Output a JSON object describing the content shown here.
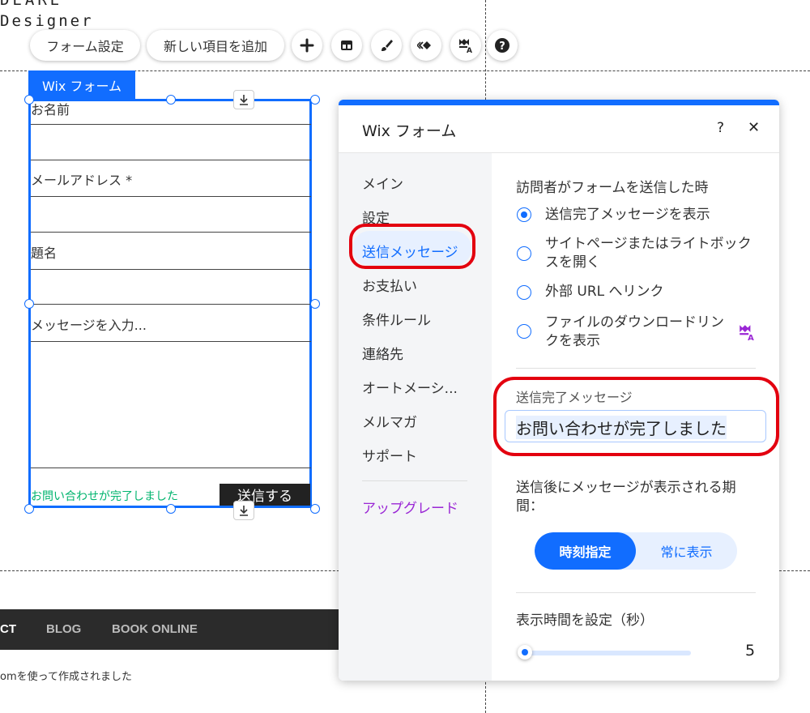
{
  "site": {
    "title_partial": "DEARE",
    "subtitle_partial": "Designer"
  },
  "toolbar": {
    "form_settings_label": "フォーム設定",
    "add_item_label": "新しい項目を追加",
    "icons": [
      "plus-icon",
      "layout-icon",
      "brush-icon",
      "animation-icon",
      "premium-icon",
      "help-icon"
    ]
  },
  "form": {
    "tag_label": "Wix フォーム",
    "fields": [
      {
        "label": "お名前"
      },
      {
        "label": "メールアドレス *"
      },
      {
        "label": "題名"
      },
      {
        "label": "メッセージを入力..."
      }
    ],
    "success_text": "お問い合わせが完了しました",
    "submit_label": "送信する",
    "success_color": "#00b46e",
    "accent": "#116dff"
  },
  "footer": {
    "nav_items": [
      "CT",
      "BLOG",
      "BOOK ONLINE"
    ],
    "credit_text": "omを使って作成されました"
  },
  "panel": {
    "title": "Wix フォーム",
    "help_glyph": "?",
    "close_glyph": "✕",
    "nav": [
      {
        "label": "メイン"
      },
      {
        "label": "設定"
      },
      {
        "label": "送信メッセージ",
        "selected": true
      },
      {
        "label": "お支払い"
      },
      {
        "label": "条件ルール"
      },
      {
        "label": "連絡先"
      },
      {
        "label": "オートメーシ..."
      },
      {
        "label": "メルマガ"
      },
      {
        "label": "サポート"
      }
    ],
    "upgrade_label": "アップグレード",
    "on_submit_title": "訪問者がフォームを送信した時",
    "options": [
      {
        "line1": "送信完了メッセージを表示",
        "line2": "",
        "selected": true
      },
      {
        "line1": "サイトページまたはライトボック",
        "line2": "スを開く",
        "selected": false
      },
      {
        "line1": "外部 URL へリンク",
        "line2": "",
        "selected": false
      },
      {
        "line1": "ファイルのダウンロードリン",
        "line2": "クを表示",
        "selected": false,
        "premium": true
      }
    ],
    "message_label": "送信完了メッセージ",
    "message_value": "お問い合わせが完了しました",
    "duration_title_line1": "送信後にメッセージが表示される期",
    "duration_title_line2": "間：",
    "toggle": {
      "options": [
        "時刻指定",
        "常に表示"
      ],
      "selected": "時刻指定"
    },
    "seconds_label": "表示時間を設定（秒）",
    "seconds_value": "5",
    "slider_fraction": 0.0
  },
  "colors": {
    "accent": "#116dff",
    "highlight_ring": "#e3000f",
    "upgrade": "#9a27d5",
    "footer_bg": "#2b2b2b"
  }
}
